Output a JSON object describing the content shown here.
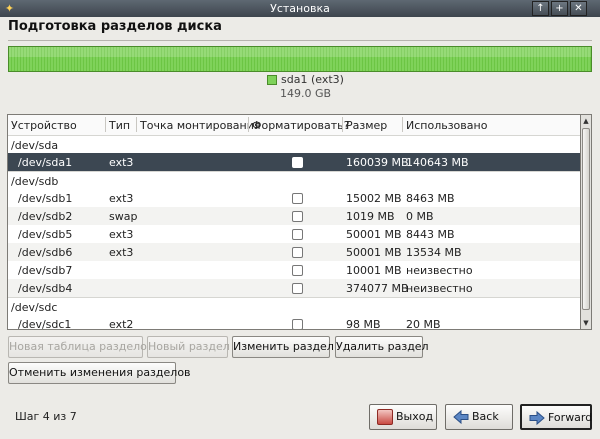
{
  "window": {
    "title": "Установка",
    "controls": [
      "pin-icon",
      "maximize-icon",
      "close-icon"
    ]
  },
  "header": {
    "title": "Подготовка разделов диска"
  },
  "partition_bar": {
    "label": "sda1 (ext3)",
    "size": "149.0 GB",
    "color": "#7fd25a"
  },
  "table": {
    "columns": [
      "Устройство",
      "Тип",
      "Точка монтирования",
      "Форматировать?",
      "Размер",
      "Использовано"
    ],
    "rows": [
      {
        "kind": "device",
        "device": "/dev/sda"
      },
      {
        "kind": "partition",
        "device": "/dev/sda1",
        "type": "ext3",
        "mount": "",
        "format": true,
        "size": "160039 MB",
        "used": "140643 MB",
        "selected": true
      },
      {
        "kind": "device",
        "device": "/dev/sdb"
      },
      {
        "kind": "partition",
        "device": "/dev/sdb1",
        "type": "ext3",
        "mount": "",
        "format": false,
        "size": "15002 MB",
        "used": "8463 MB"
      },
      {
        "kind": "partition",
        "device": "/dev/sdb2",
        "type": "swap",
        "mount": "",
        "format": false,
        "size": "1019 MB",
        "used": "0 MB"
      },
      {
        "kind": "partition",
        "device": "/dev/sdb5",
        "type": "ext3",
        "mount": "",
        "format": false,
        "size": "50001 MB",
        "used": "8443 MB"
      },
      {
        "kind": "partition",
        "device": "/dev/sdb6",
        "type": "ext3",
        "mount": "",
        "format": false,
        "size": "50001 MB",
        "used": "13534 MB"
      },
      {
        "kind": "partition",
        "device": "/dev/sdb7",
        "type": "",
        "mount": "",
        "format": false,
        "size": "10001 MB",
        "used": "неизвестно"
      },
      {
        "kind": "partition",
        "device": "/dev/sdb4",
        "type": "",
        "mount": "",
        "format": false,
        "size": "374077 MB",
        "used": "неизвестно"
      },
      {
        "kind": "device",
        "device": "/dev/sdc"
      },
      {
        "kind": "partition",
        "device": "/dev/sdc1",
        "type": "ext2",
        "mount": "",
        "format": false,
        "size": "98 MB",
        "used": "20 MB"
      }
    ]
  },
  "actions": {
    "new_table": "Новая таблица разделов",
    "new_partition": "Новый раздел",
    "edit_partition": "Изменить раздел",
    "delete_partition": "Удалить раздел",
    "undo_changes": "Отменить изменения разделов"
  },
  "footer": {
    "step": "Шаг 4 из 7",
    "quit": "Выход",
    "back": "Back",
    "forward": "Forward"
  },
  "colors": {
    "titlebar": "#4a535c",
    "selected_row": "#3c4752",
    "partition": "#7fd25a"
  }
}
